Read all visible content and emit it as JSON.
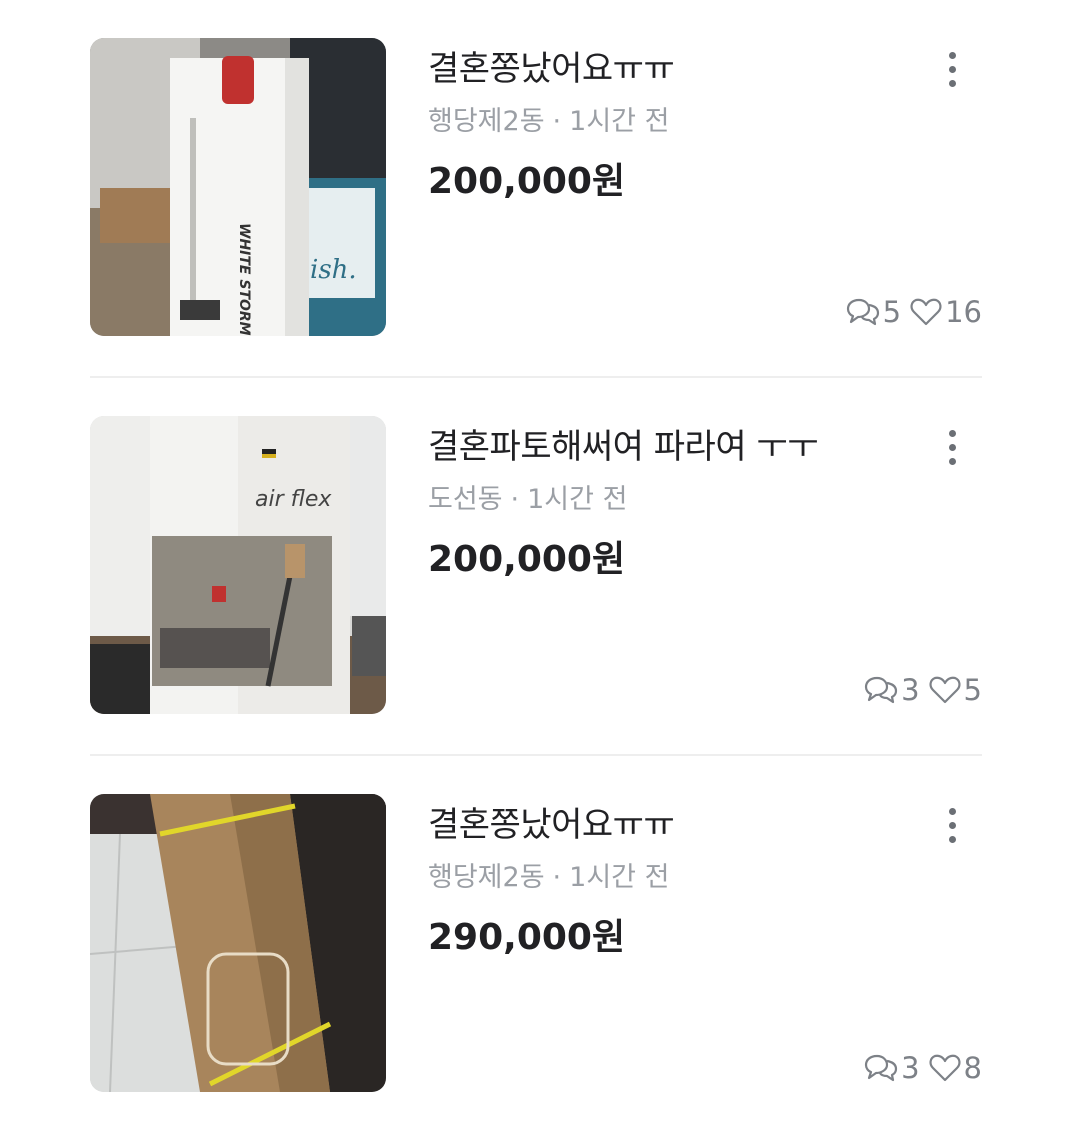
{
  "listings": [
    {
      "title": "결혼쫑났어요ㅠㅠ",
      "location": "행당제2동",
      "time": "1시간 전",
      "price": "200,000원",
      "chats": "5",
      "likes": "16",
      "image_text": [
        "WHITE STORM",
        "ish."
      ]
    },
    {
      "title": "결혼파토해써여 파라여 ㅜㅜ",
      "location": "도선동",
      "time": "1시간 전",
      "price": "200,000원",
      "chats": "3",
      "likes": "5",
      "image_text": [
        "air flex"
      ]
    },
    {
      "title": "결혼쫑났어요ㅠㅠ",
      "location": "행당제2동",
      "time": "1시간 전",
      "price": "290,000원",
      "chats": "3",
      "likes": "8",
      "image_text": []
    }
  ],
  "separator": "·",
  "icons": {
    "more": "more-vertical-icon",
    "chat": "chat-bubble-icon",
    "like": "heart-outline-icon"
  },
  "colors": {
    "text_primary": "#212124",
    "text_secondary": "#9b9fa5",
    "stat_gray": "#7d8187",
    "divider": "#eeeeee"
  }
}
